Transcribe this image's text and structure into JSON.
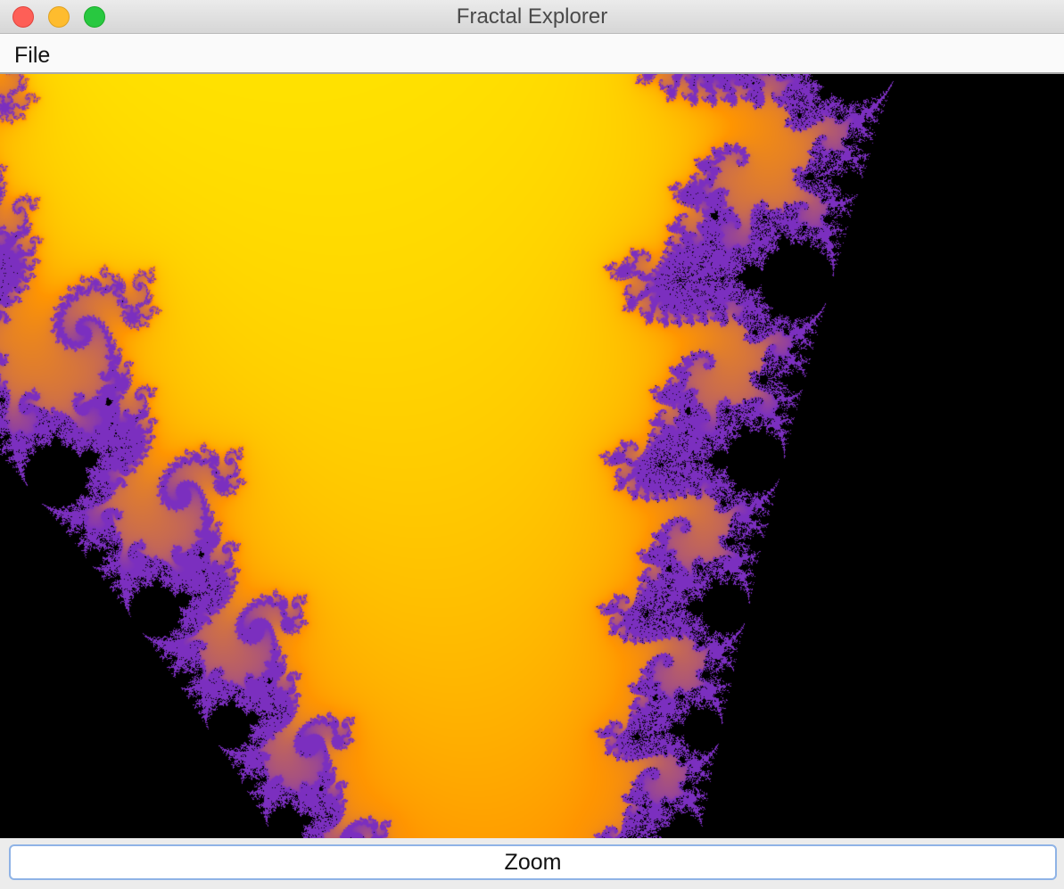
{
  "window": {
    "title": "Fractal Explorer"
  },
  "menubar": {
    "file_label": "File"
  },
  "canvas": {
    "name": "fractal-image",
    "palette": {
      "outer_dark": "#2f5fa0",
      "outer_light": "#7af0fa",
      "edge_yellow": "#ffec00",
      "edge_orange": "#ff9500",
      "edge_purple": "#7b2fbf",
      "set_color": "#000000"
    }
  },
  "controls": {
    "zoom_label": "Zoom"
  }
}
